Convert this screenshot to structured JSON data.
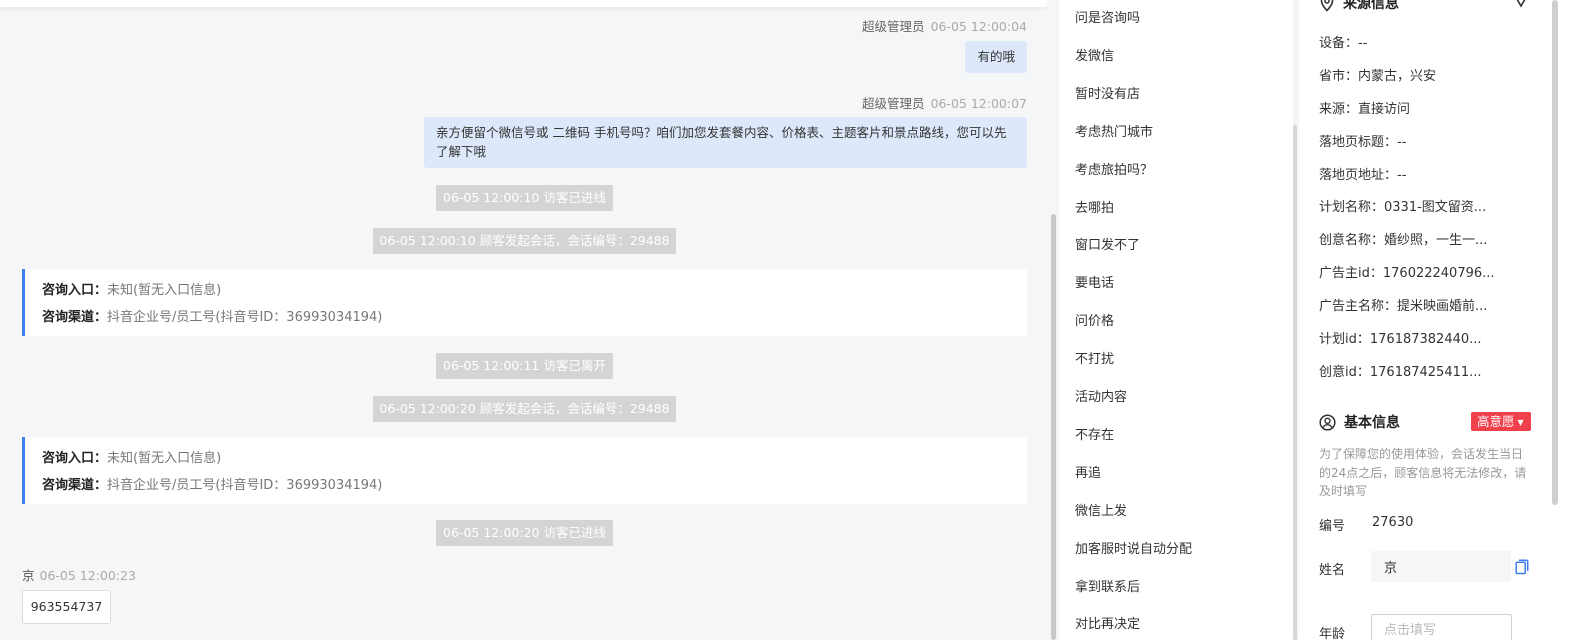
{
  "chat": {
    "messages_out": [
      {
        "sender": "超级管理员",
        "time": "06-05 12:00:04",
        "text": "有的哦"
      },
      {
        "sender": "超级管理员",
        "time": "06-05 12:00:07",
        "text": "亲方便留个微信号或 二维码 手机号吗？咱们加您发套餐内容、价格表、主题客片和景点路线，您可以先了解下哦"
      }
    ],
    "system": [
      "06-05 12:00:10 访客已进线",
      "06-05 12:00:10 顾客发起会话，会话编号：29488",
      "06-05 12:00:11 访客已离开",
      "06-05 12:00:20 顾客发起会话，会话编号：29488",
      "06-05 12:00:20 访客已进线"
    ],
    "cards": [
      {
        "entry_label": "咨询入口：",
        "entry_value": "未知(暂无入口信息)",
        "channel_label": "咨询渠道：",
        "channel_value": "抖音企业号/员工号(抖音号ID：36993034194)"
      },
      {
        "entry_label": "咨询入口：",
        "entry_value": "未知(暂无入口信息)",
        "channel_label": "咨询渠道：",
        "channel_value": "抖音企业号/员工号(抖音号ID：36993034194)"
      }
    ],
    "visitor": {
      "name": "京",
      "time": "06-05 12:00:23",
      "text": "963554737"
    }
  },
  "quick_replies": [
    "问是咨询吗",
    "发微信",
    "暂时没有店",
    "考虑热门城市",
    "考虑旅拍吗？",
    "去哪拍",
    "窗口发不了",
    "要电话",
    "问价格",
    "不打扰",
    "活动内容",
    "不存在",
    "再追",
    "微信上发",
    "加客服时说自动分配",
    "拿到联系后",
    "对比再决定"
  ],
  "source": {
    "title": "来源信息",
    "fields": [
      {
        "k": "设备：",
        "v": "--"
      },
      {
        "k": "省市：",
        "v": "内蒙古，兴安"
      },
      {
        "k": "来源：",
        "v": "直接访问"
      },
      {
        "k": "落地页标题：",
        "v": "--"
      },
      {
        "k": "落地页地址：",
        "v": "--"
      },
      {
        "k": "计划名称：",
        "v": "0331-图文留资..."
      },
      {
        "k": "创意名称：",
        "v": "婚纱照，一生一..."
      },
      {
        "k": "广告主id：",
        "v": "176022240796..."
      },
      {
        "k": "广告主名称：",
        "v": "提米映画婚前..."
      },
      {
        "k": "计划id：",
        "v": "176187382440..."
      },
      {
        "k": "创意id：",
        "v": "176187425411..."
      }
    ]
  },
  "basic": {
    "title": "基本信息",
    "intent": "高意愿",
    "notice": "为了保障您的使用体验，会话发生当日的24点之后，顾客信息将无法修改，请及时填写",
    "number_label": "编号",
    "number_value": "27630",
    "name_label": "姓名",
    "name_value": "京",
    "age_label": "年龄",
    "age_placeholder": "点击填写"
  },
  "colors": {
    "accent": "#3d7ff2",
    "badge": "#f0404c",
    "bubble": "#dde9fb",
    "system_pill": "#d4d4d4"
  }
}
